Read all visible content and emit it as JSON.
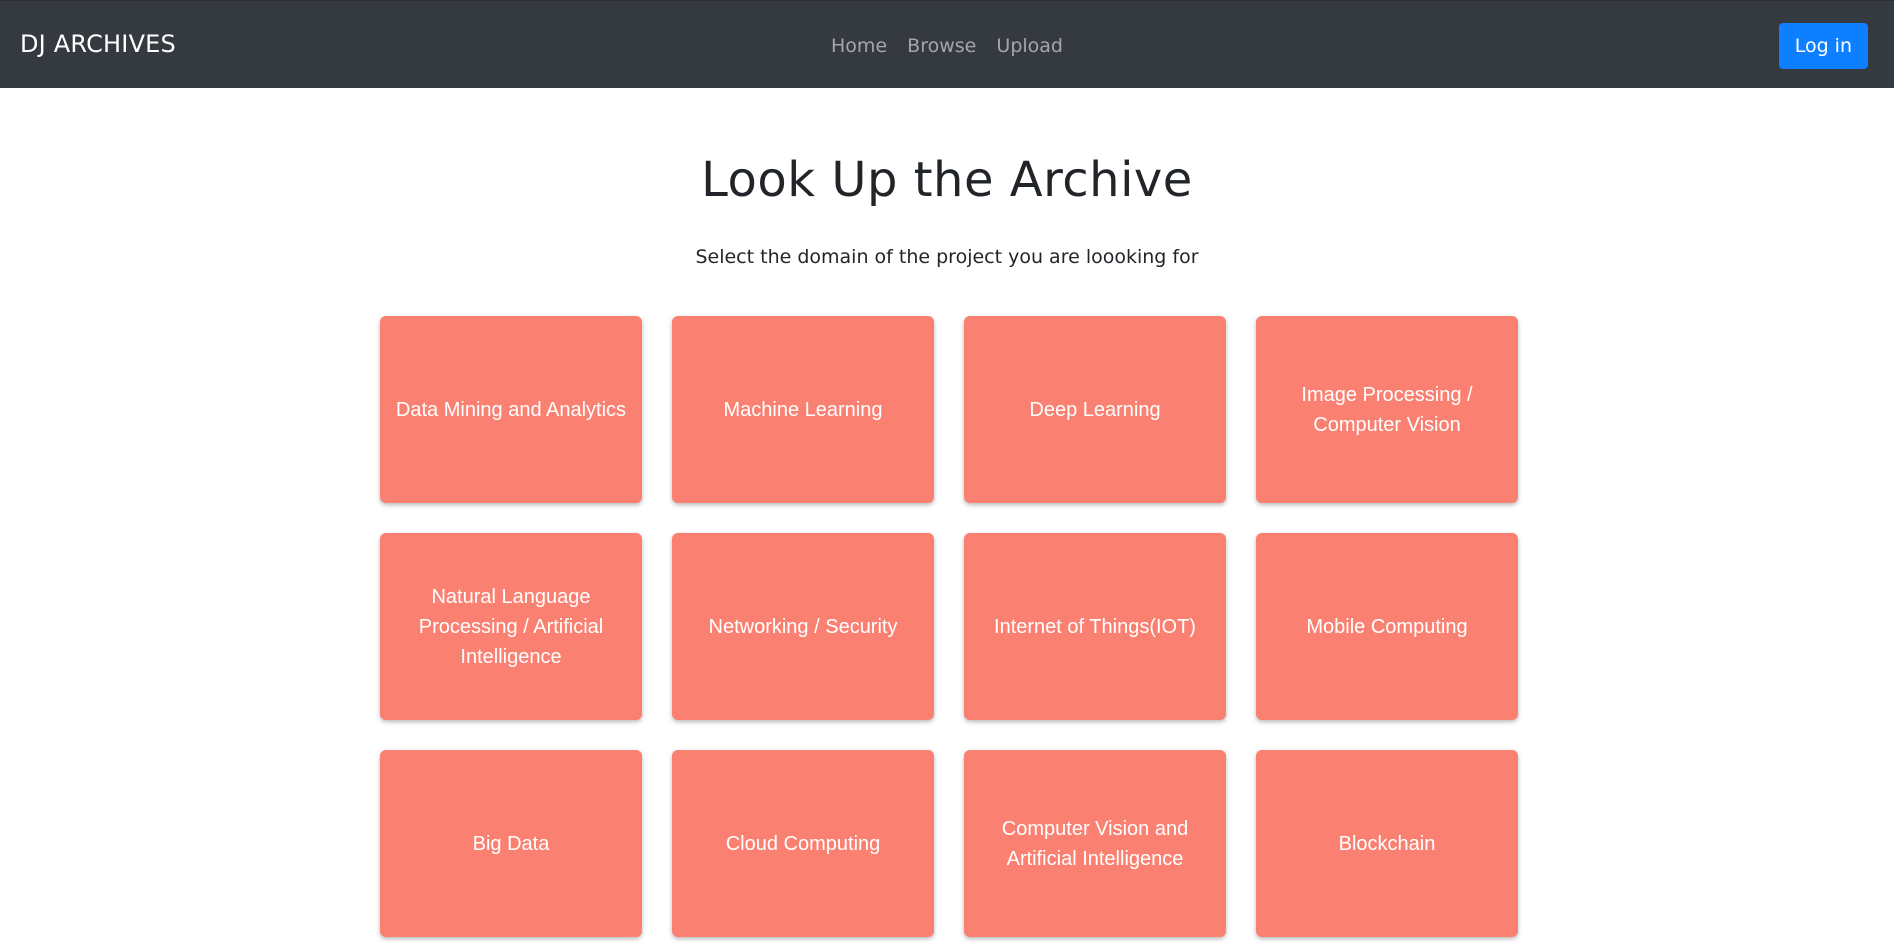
{
  "navbar": {
    "brand": "DJ ARCHIVES",
    "links": [
      "Home",
      "Browse",
      "Upload"
    ],
    "login_label": "Log in"
  },
  "main": {
    "title": "Look Up the Archive",
    "subtitle": "Select the domain of the project you are loooking for",
    "domains": [
      "Data Mining and Analytics",
      "Machine Learning",
      "Deep Learning",
      "Image Processing / Computer Vision",
      "Natural Language Processing / Artificial Intelligence",
      "Networking / Security",
      "Internet of Things(IOT)",
      "Mobile Computing",
      "Big Data",
      "Cloud Computing",
      "Computer Vision and Artificial Intelligence",
      "Blockchain"
    ]
  },
  "colors": {
    "navbar_bg": "#343a40",
    "card_bg": "#fa8072",
    "primary_button": "#0d7fff"
  }
}
